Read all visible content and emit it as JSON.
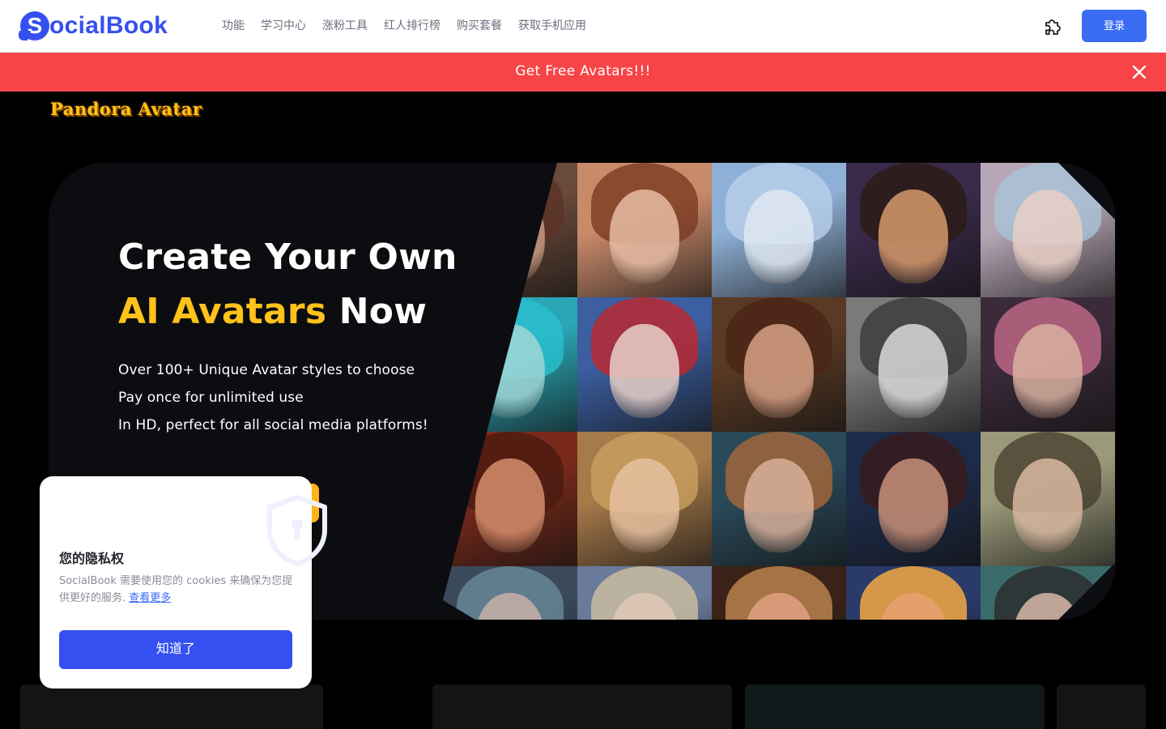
{
  "nav": {
    "logo_letter": "S",
    "logo_text": "ocialBook",
    "links": [
      "功能",
      "学习中心",
      "涨粉工具",
      "红人排行榜",
      "购买套餐",
      "获取手机应用"
    ],
    "extension_icon": "puzzle-piece-icon",
    "login_label": "登录"
  },
  "banner": {
    "text": "Get Free Avatars!!!",
    "close_icon": "close-icon",
    "color": "#f74447"
  },
  "hero": {
    "brand": "Pandora Avatar",
    "title_line1": "Create Your Own",
    "title_accent": "AI Avatars",
    "title_rest": " Now",
    "bullets": [
      "Over 100+ Unique Avatar styles to choose",
      "Pay once for unlimited use",
      "In HD, perfect for all social media platforms!"
    ],
    "accent_color": "#ffc21a"
  },
  "cookie": {
    "title": "您的隐私权",
    "body": "SocialBook 需要使用您的 cookies 来确保为您提供更好的服务.",
    "link": "查看更多",
    "button": "知道了",
    "icon": "shield-lock-icon"
  }
}
